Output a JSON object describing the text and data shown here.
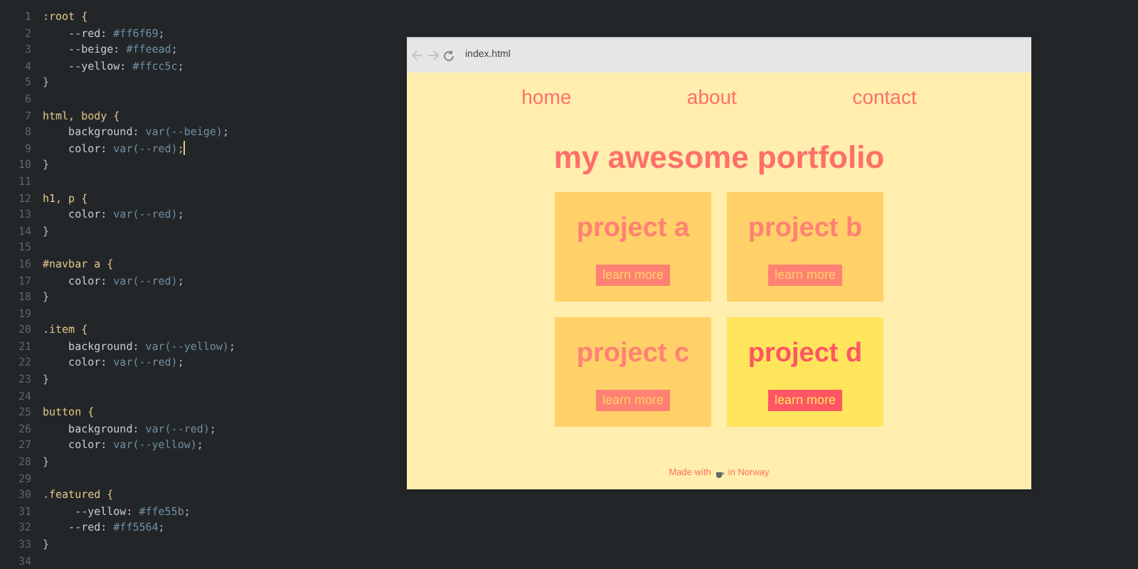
{
  "editor": {
    "lines": [
      {
        "number": "1",
        "tokens": [
          {
            "text": ":root {",
            "kind": "selector"
          }
        ]
      },
      {
        "number": "2",
        "tokens": [
          {
            "text": "    --red: ",
            "kind": "property"
          },
          {
            "text": "#ff6f69",
            "kind": "value"
          },
          {
            "text": ";",
            "kind": "punct"
          }
        ]
      },
      {
        "number": "3",
        "tokens": [
          {
            "text": "    --beige: ",
            "kind": "property"
          },
          {
            "text": "#ffeead",
            "kind": "value"
          },
          {
            "text": ";",
            "kind": "punct"
          }
        ]
      },
      {
        "number": "4",
        "tokens": [
          {
            "text": "    --yellow: ",
            "kind": "property"
          },
          {
            "text": "#ffcc5c",
            "kind": "value"
          },
          {
            "text": ";",
            "kind": "punct"
          }
        ]
      },
      {
        "number": "5",
        "tokens": [
          {
            "text": "}",
            "kind": "punct"
          }
        ]
      },
      {
        "number": "6"
      },
      {
        "number": "7",
        "tokens": [
          {
            "text": "html, body {",
            "kind": "selector"
          }
        ]
      },
      {
        "number": "8",
        "tokens": [
          {
            "text": "    background: ",
            "kind": "property"
          },
          {
            "text": "var(--beige)",
            "kind": "value"
          },
          {
            "text": ";",
            "kind": "punct"
          }
        ]
      },
      {
        "number": "9",
        "tokens": [
          {
            "text": "    color: ",
            "kind": "property"
          },
          {
            "text": "var(--red)",
            "kind": "value"
          },
          {
            "text": ";",
            "kind": "punct"
          }
        ],
        "cursor": true
      },
      {
        "number": "10",
        "tokens": [
          {
            "text": "}",
            "kind": "punct"
          }
        ]
      },
      {
        "number": "11"
      },
      {
        "number": "12",
        "tokens": [
          {
            "text": "h1, p {",
            "kind": "selector"
          }
        ]
      },
      {
        "number": "13",
        "tokens": [
          {
            "text": "    color: ",
            "kind": "property"
          },
          {
            "text": "var(--red)",
            "kind": "value"
          },
          {
            "text": ";",
            "kind": "punct"
          }
        ]
      },
      {
        "number": "14",
        "tokens": [
          {
            "text": "}",
            "kind": "punct"
          }
        ]
      },
      {
        "number": "15"
      },
      {
        "number": "16",
        "tokens": [
          {
            "text": "#navbar a {",
            "kind": "selector"
          }
        ]
      },
      {
        "number": "17",
        "tokens": [
          {
            "text": "    color: ",
            "kind": "property"
          },
          {
            "text": "var(--red)",
            "kind": "value"
          },
          {
            "text": ";",
            "kind": "punct"
          }
        ]
      },
      {
        "number": "18",
        "tokens": [
          {
            "text": "}",
            "kind": "punct"
          }
        ]
      },
      {
        "number": "19"
      },
      {
        "number": "20",
        "tokens": [
          {
            "text": ".item {",
            "kind": "selector"
          }
        ]
      },
      {
        "number": "21",
        "tokens": [
          {
            "text": "    background: ",
            "kind": "property"
          },
          {
            "text": "var(--yellow)",
            "kind": "value"
          },
          {
            "text": ";",
            "kind": "punct"
          }
        ]
      },
      {
        "number": "22",
        "tokens": [
          {
            "text": "    color: ",
            "kind": "property"
          },
          {
            "text": "var(--red)",
            "kind": "value"
          },
          {
            "text": ";",
            "kind": "punct"
          }
        ]
      },
      {
        "number": "23",
        "tokens": [
          {
            "text": "}",
            "kind": "punct"
          }
        ]
      },
      {
        "number": "24"
      },
      {
        "number": "25",
        "tokens": [
          {
            "text": "button {",
            "kind": "selector"
          }
        ]
      },
      {
        "number": "26",
        "tokens": [
          {
            "text": "    background: ",
            "kind": "property"
          },
          {
            "text": "var(--red)",
            "kind": "value"
          },
          {
            "text": ";",
            "kind": "punct"
          }
        ]
      },
      {
        "number": "27",
        "tokens": [
          {
            "text": "    color: ",
            "kind": "property"
          },
          {
            "text": "var(--yellow)",
            "kind": "value"
          },
          {
            "text": ";",
            "kind": "punct"
          }
        ]
      },
      {
        "number": "28",
        "tokens": [
          {
            "text": "}",
            "kind": "punct"
          }
        ]
      },
      {
        "number": "29"
      },
      {
        "number": "30",
        "tokens": [
          {
            "text": ".featured {",
            "kind": "selector"
          }
        ]
      },
      {
        "number": "31",
        "tokens": [
          {
            "text": "     --yellow: ",
            "kind": "property"
          },
          {
            "text": "#ffe55b",
            "kind": "value"
          },
          {
            "text": ";",
            "kind": "punct"
          }
        ]
      },
      {
        "number": "32",
        "tokens": [
          {
            "text": "    --red: ",
            "kind": "property"
          },
          {
            "text": "#ff5564",
            "kind": "value"
          },
          {
            "text": ";",
            "kind": "punct"
          }
        ]
      },
      {
        "number": "33",
        "tokens": [
          {
            "text": "}",
            "kind": "punct"
          }
        ]
      },
      {
        "number": "34"
      }
    ]
  },
  "browser": {
    "address": "index.html",
    "nav": [
      "home",
      "about",
      "contact"
    ],
    "heading": "my awesome portfolio",
    "projects": [
      {
        "title": "project a",
        "button": "learn more",
        "featured": false
      },
      {
        "title": "project b",
        "button": "learn more",
        "featured": false
      },
      {
        "title": "project c",
        "button": "learn more",
        "featured": false
      },
      {
        "title": "project d",
        "button": "learn more",
        "featured": true
      }
    ],
    "footer": {
      "before": "Made with",
      "after": "in Norway"
    }
  }
}
